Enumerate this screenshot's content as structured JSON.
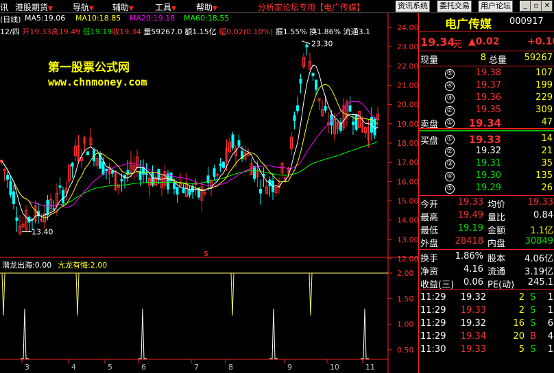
{
  "menu": {
    "items": [
      {
        "label": "讯"
      },
      {
        "label": "港股期货"
      },
      {
        "label": "导航"
      },
      {
        "label": "辅助"
      },
      {
        "label": "工具"
      },
      {
        "label": "帮助"
      }
    ],
    "promo": "分析家论坛专用【电广传媒】",
    "buttons": [
      "资讯系统",
      "委托交易",
      "用户论坛"
    ]
  },
  "chart_header": {
    "period": "(日线)",
    "ma5": "MA5:19.06",
    "ma10": "MA10:18.85",
    "ma20": "MA20:19.18",
    "ma60": "MA60:18.55",
    "info_date": "12/四",
    "info_open": "开19.33",
    "info_high": "高19.49",
    "info_low": "低19.19",
    "info_close": "收19.34",
    "info_vol": "量59267.0",
    "info_amt": "额1.15亿",
    "info_chg": "幅0.02(0.10%)",
    "info_amp": "振1.55%",
    "info_turn": "换1.86%",
    "info_float": "流通3.1"
  },
  "watermark": {
    "title": "第一股票公式网",
    "url": "www.chnmoney.com"
  },
  "indicator": {
    "name1": "潜龙出海:0.00",
    "name2": "亢龙有悔:2.00"
  },
  "colors": {
    "ma5": "#ffffff",
    "ma10": "#ffff00",
    "ma20": "#ff00ff",
    "ma60": "#00ff00",
    "up": "#ff3030",
    "down": "#00ffff"
  },
  "chart_data": {
    "type": "candlestick",
    "y_ticks": [
      "24.00",
      "23.00",
      "22.00",
      "21.00",
      "20.00",
      "19.00",
      "18.00",
      "17.00",
      "16.00",
      "15.00",
      "14.00",
      "13.00",
      "12.00"
    ],
    "ylim": [
      12.0,
      24.0
    ],
    "x_ticks": [
      "3",
      "4",
      "5",
      "6",
      "7",
      "8",
      "9",
      "10",
      "11"
    ],
    "annotations": [
      "23.30",
      "13.40"
    ],
    "indicator_ticks": [
      "2.00",
      "1.50",
      "1.00",
      "0.50"
    ],
    "indicator_ylim": [
      0.0,
      2.0
    ]
  },
  "quote": {
    "name": "电广传媒",
    "code": "000917",
    "price": "19.34",
    "price_unit": "元",
    "change": "▲0.02",
    "change2": "+0.10",
    "cur_vol_label": "现量",
    "cur_vol": "8",
    "tot_vol_label": "总量",
    "tot_vol": "59267",
    "asks": [
      {
        "n": "⑤",
        "p": "19.38",
        "v": "107"
      },
      {
        "n": "④",
        "p": "19.37",
        "v": "199"
      },
      {
        "n": "③",
        "p": "19.36",
        "v": "229"
      },
      {
        "n": "②",
        "p": "19.35",
        "v": "309"
      }
    ],
    "ask1": {
      "label": "卖盘",
      "n": "①",
      "p": "19.34",
      "v": "47"
    },
    "bid1": {
      "label": "买盘",
      "n": "①",
      "p": "19.33",
      "v": "14"
    },
    "bids": [
      {
        "n": "②",
        "p": "19.32",
        "v": "21"
      },
      {
        "n": "③",
        "p": "19.31",
        "v": "35"
      },
      {
        "n": "④",
        "p": "19.30",
        "v": "135"
      },
      {
        "n": "⑤",
        "p": "19.29",
        "v": "26"
      }
    ],
    "stats": [
      {
        "l1": "今开",
        "v1": "19.33",
        "l2": "均价",
        "v2": "19.33"
      },
      {
        "l1": "最高",
        "v1": "19.49",
        "l2": "量比",
        "v2": "0.84"
      },
      {
        "l1": "最低",
        "v1": "19.19",
        "l2": "金额",
        "v2": "1.1亿"
      },
      {
        "l1": "外盘",
        "v1": "28418",
        "l2": "内盘",
        "v2": "30849"
      }
    ],
    "stats2": [
      {
        "l1": "换手",
        "v1": "1.86%",
        "l2": "股本",
        "v2": "4.06亿"
      },
      {
        "l1": "净资",
        "v1": "4.16",
        "l2": "流通",
        "v2": "3.19亿"
      },
      {
        "l1": "收益(三)",
        "v1": "0.06",
        "l2": "PE(动)",
        "v2": "245.1"
      }
    ],
    "ticks": [
      {
        "t": "11:29",
        "p": "19.32",
        "v": "2",
        "s": "S",
        "x": "1"
      },
      {
        "t": "11:29",
        "p": "19.33",
        "v": "2",
        "s": "S",
        "x": "1"
      },
      {
        "t": "11:29",
        "p": "19.32",
        "v": "16",
        "s": "S",
        "x": "6"
      },
      {
        "t": "11:29",
        "p": "19.34",
        "v": "20",
        "s": "B",
        "x": "4"
      },
      {
        "t": "11:30",
        "p": "19.33",
        "v": "5",
        "s": "S",
        "x": "1"
      }
    ]
  }
}
